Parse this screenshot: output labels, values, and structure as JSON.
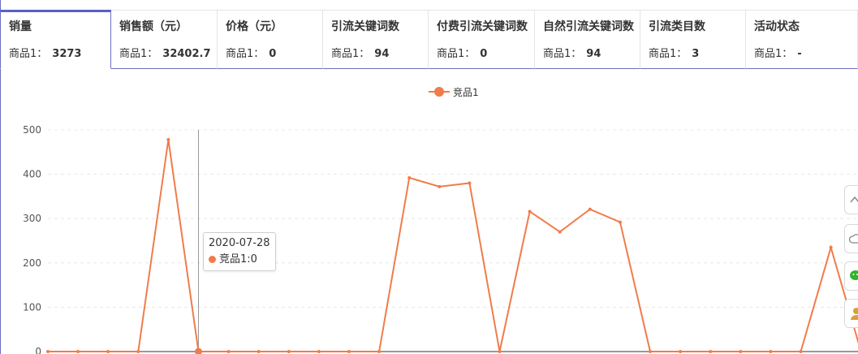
{
  "tabs": [
    {
      "title": "销量",
      "item": "商品1：",
      "value": "3273",
      "active": true,
      "width": 137
    },
    {
      "title": "销售额（元）",
      "item": "商品1：",
      "value": "32402.7",
      "width": 131
    },
    {
      "title": "价格（元）",
      "item": "商品1：",
      "value": "0",
      "width": 130
    },
    {
      "title": "引流关键词数",
      "item": "商品1：",
      "value": "94",
      "width": 130
    },
    {
      "title": "付费引流关键词数",
      "item": "商品1：",
      "value": "0",
      "width": 131
    },
    {
      "title": "自然引流关键词数",
      "item": "商品1：",
      "value": "94",
      "width": 130
    },
    {
      "title": "引流类目数",
      "item": "商品1：",
      "value": "3",
      "width": 130
    },
    {
      "title": "活动状态",
      "item": "商品1：",
      "value": "-",
      "width": 138
    }
  ],
  "chart_data": {
    "type": "line",
    "xlabel": "",
    "ylabel": "",
    "ylim": [
      0,
      500
    ],
    "yticks": [
      0,
      100,
      200,
      300,
      400,
      500
    ],
    "grid": true,
    "legend": "top-center",
    "series": [
      {
        "name": "竞品1",
        "color": "#f07c4a",
        "values": [
          0,
          0,
          0,
          0,
          478,
          0,
          0,
          0,
          0,
          0,
          0,
          0,
          392,
          372,
          380,
          0,
          316,
          270,
          321,
          292,
          0,
          0,
          0,
          0,
          0,
          0,
          235,
          0
        ]
      }
    ],
    "tooltip": {
      "date": "2020-07-28",
      "label": "竞品1:0",
      "index": 5
    }
  },
  "icons": [
    "up-arrow-icon",
    "cloud-icon",
    "wechat-icon",
    "user-icon"
  ]
}
